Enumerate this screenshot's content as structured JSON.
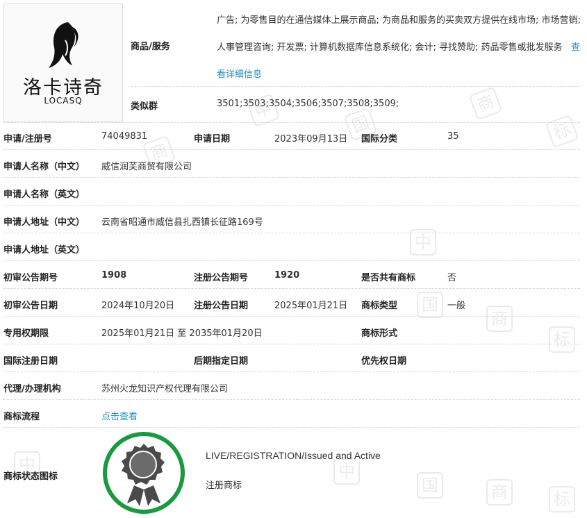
{
  "logo": {
    "cn_text": "洛卡诗奇",
    "en_text": "LOCASQ"
  },
  "goods": {
    "label": "商品/服务",
    "text": "广告; 为零售目的在通信媒体上展示商品; 为商品和服务的买卖双方提供在线市场; 市场营销; 人事管理咨询; 开发票; 计算机数据库信息系统化; 会计; 寻找赞助; 药品零售或批发服务",
    "detail_link": "查看详细信息"
  },
  "similar_group": {
    "label": "类似群",
    "value": "3501;3503;3504;3506;3507;3508;3509;"
  },
  "application": {
    "reg_no_label": "申请/注册号",
    "reg_no": "74049831",
    "date_label": "申请日期",
    "date": "2023年09月13日",
    "intl_class_label": "国际分类",
    "intl_class": "35"
  },
  "applicant": {
    "name_cn_label": "申请人名称（中文）",
    "name_cn": "威信润芙商贸有限公司",
    "name_en_label": "申请人名称（英文）",
    "name_en": "",
    "addr_cn_label": "申请人地址（中文）",
    "addr_cn": "云南省昭通市威信县扎西镇长征路169号",
    "addr_en_label": "申请人地址（英文）",
    "addr_en": ""
  },
  "announce": {
    "prelim_no_label": "初审公告期号",
    "prelim_no": "1908",
    "reg_no_label": "注册公告期号",
    "reg_no": "1920",
    "shared_label": "是否共有商标",
    "shared": "否",
    "prelim_date_label": "初审公告日期",
    "prelim_date": "2024年10月20日",
    "reg_date_label": "注册公告日期",
    "reg_date": "2025年01月21日",
    "type_label": "商标类型",
    "type": "一般"
  },
  "rights": {
    "period_label": "专用权期限",
    "period": "2025年01月21日 至 2035年01月20日",
    "form_label": "商标形式",
    "form": ""
  },
  "dates": {
    "intl_reg_label": "国际注册日期",
    "later_label": "后期指定日期",
    "priority_label": "优先权日期"
  },
  "agent": {
    "label": "代理/办理机构",
    "value": "苏州火龙知识产权代理有限公司"
  },
  "process": {
    "label": "商标流程",
    "link": "点击查看"
  },
  "status": {
    "label": "商标状态图标",
    "line1": "LIVE/REGISTRATION/Issued and Active",
    "line2": "注册商标"
  },
  "colors": {
    "link": "#1e8fc6",
    "badge_ring": "#1a9a3c",
    "badge_fill": "#4a4a4a"
  }
}
